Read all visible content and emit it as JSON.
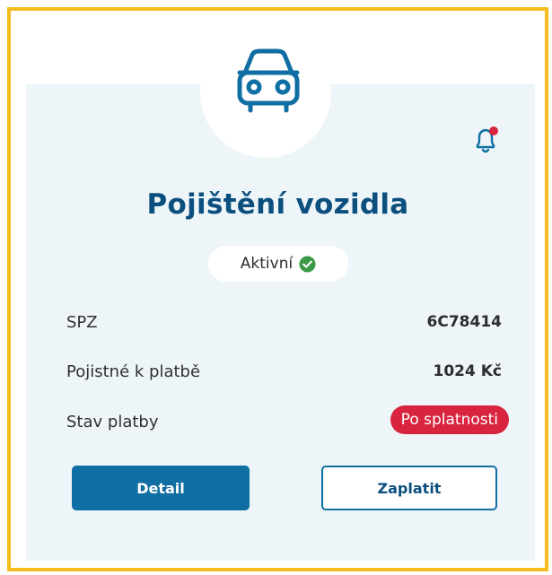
{
  "card": {
    "icon": "car-icon",
    "title": "Pojištění vozidla",
    "status": {
      "label": "Aktivní",
      "icon": "check-circle-icon",
      "color": "#3b9a47"
    },
    "notification_icon": "bell-icon",
    "notification_dot_color": "#d8243f",
    "rows": [
      {
        "label": "SPZ",
        "value": "6C78414"
      },
      {
        "label": "Pojistné k platbě",
        "value": "1024 Kč"
      },
      {
        "label": "Stav platby",
        "value": "Po splatnosti",
        "badge_color": "#d8243f"
      }
    ],
    "buttons": {
      "detail": "Detail",
      "pay": "Zaplatit"
    }
  },
  "colors": {
    "frame": "#f5bd1f",
    "card_bg": "#eef5f8",
    "accent": "#0f6ea3",
    "title": "#0b4f7f"
  }
}
